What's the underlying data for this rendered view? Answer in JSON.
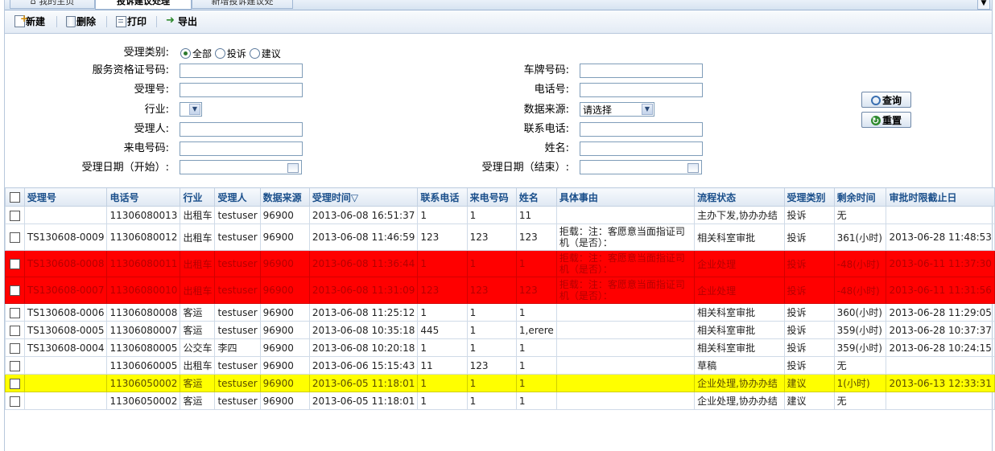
{
  "tabs": [
    "我的主页",
    "投诉建议处理",
    "新增投诉建议处"
  ],
  "toolbar": {
    "new": "新建",
    "delete": "删除",
    "print": "打印",
    "export": "导出"
  },
  "form": {
    "type_label": "受理类别:",
    "type_options": [
      "全部",
      "投诉",
      "建议"
    ],
    "type_selected": "全部",
    "cert_label": "服务资格证号码:",
    "plate_label": "车牌号码:",
    "accept_no_label": "受理号:",
    "phone_label": "电话号:",
    "industry_label": "行业:",
    "source_label": "数据来源:",
    "source_value": "请选择",
    "acceptor_label": "受理人:",
    "contact_label": "联系电话:",
    "caller_label": "来电号码:",
    "name_label": "姓名:",
    "date_start_label": "受理日期（开始）:",
    "date_end_label": "受理日期（结束）:",
    "query_button": "查询",
    "reset_button": "重置"
  },
  "table": {
    "columns": [
      "受理号",
      "电话号",
      "行业",
      "受理人",
      "数据来源",
      "受理时间▽",
      "联系电话",
      "来电号码",
      "姓名",
      "具体事由",
      "流程状态",
      "受理类别",
      "剩余时间",
      "审批时限截止日"
    ],
    "rows": [
      {
        "style": "normal",
        "cells": [
          "",
          "11306080013",
          "出租车",
          "testuser",
          "96900",
          "2013-06-08 16:51:37",
          "1",
          "1",
          "11",
          "",
          "主办下发,协办办结",
          "投诉",
          "无",
          ""
        ]
      },
      {
        "style": "normal-tall",
        "cells": [
          "TS130608-0009",
          "11306080012",
          "出租车",
          "testuser",
          "96900",
          "2013-06-08 11:46:59",
          "123",
          "123",
          "123",
          "拒载：注：客愿意当面指证司机（是否）：",
          "相关科室审批",
          "投诉",
          "361(小时)",
          "2013-06-28 11:48:53"
        ]
      },
      {
        "style": "red",
        "cells": [
          "TS130608-0008",
          "11306080011",
          "出租车",
          "testuser",
          "96900",
          "2013-06-08 11:36:44",
          "1",
          "1",
          "1",
          "拒载：注：客愿意当面指证司机（是否）：",
          "企业处理",
          "投诉",
          "-48(小时)",
          "2013-06-11 11:37:30"
        ]
      },
      {
        "style": "red",
        "cells": [
          "TS130608-0007",
          "11306080010",
          "出租车",
          "testuser",
          "96900",
          "2013-06-08 11:31:09",
          "123",
          "123",
          "123",
          "拒载：注：客愿意当面指证司机（是否）：",
          "企业处理",
          "投诉",
          "-48(小时)",
          "2013-06-11 11:31:56"
        ]
      },
      {
        "style": "normal",
        "cells": [
          "TS130608-0006",
          "11306080008",
          "客运",
          "testuser",
          "96900",
          "2013-06-08 11:25:12",
          "1",
          "1",
          "1",
          "",
          "相关科室审批",
          "投诉",
          "360(小时)",
          "2013-06-28 11:29:05"
        ]
      },
      {
        "style": "normal",
        "cells": [
          "TS130608-0005",
          "11306080007",
          "客运",
          "testuser",
          "96900",
          "2013-06-08 10:35:18",
          "445",
          "1",
          "1,erere",
          "",
          "相关科室审批",
          "投诉",
          "359(小时)",
          "2013-06-28 10:37:37"
        ]
      },
      {
        "style": "normal",
        "cells": [
          "TS130608-0004",
          "11306080005",
          "公交车",
          "李四",
          "96900",
          "2013-06-08 10:20:18",
          "1",
          "1",
          "1",
          "",
          "相关科室审批",
          "投诉",
          "359(小时)",
          "2013-06-28 10:24:15"
        ]
      },
      {
        "style": "normal",
        "cells": [
          "",
          "11306060005",
          "出租车",
          "testuser",
          "96900",
          "2013-06-06 15:15:43",
          "11",
          "123",
          "1",
          "",
          "草稿",
          "投诉",
          "无",
          ""
        ]
      },
      {
        "style": "yellow",
        "cells": [
          "",
          "11306050002",
          "客运",
          "testuser",
          "96900",
          "2013-06-05 11:18:01",
          "1",
          "1",
          "1",
          "",
          "企业处理,协办办结",
          "建议",
          "1(小时)",
          "2013-06-13 12:33:31"
        ]
      },
      {
        "style": "normal",
        "cells": [
          "",
          "11306050002",
          "客运",
          "testuser",
          "96900",
          "2013-06-05 11:18:01",
          "1",
          "1",
          "1",
          "",
          "企业处理,协办办结",
          "建议",
          "无",
          ""
        ]
      }
    ]
  },
  "colors": {
    "overdue_row": "#ff0000",
    "warning_row": "#ffff00",
    "header_text": "#1a4f8b"
  }
}
